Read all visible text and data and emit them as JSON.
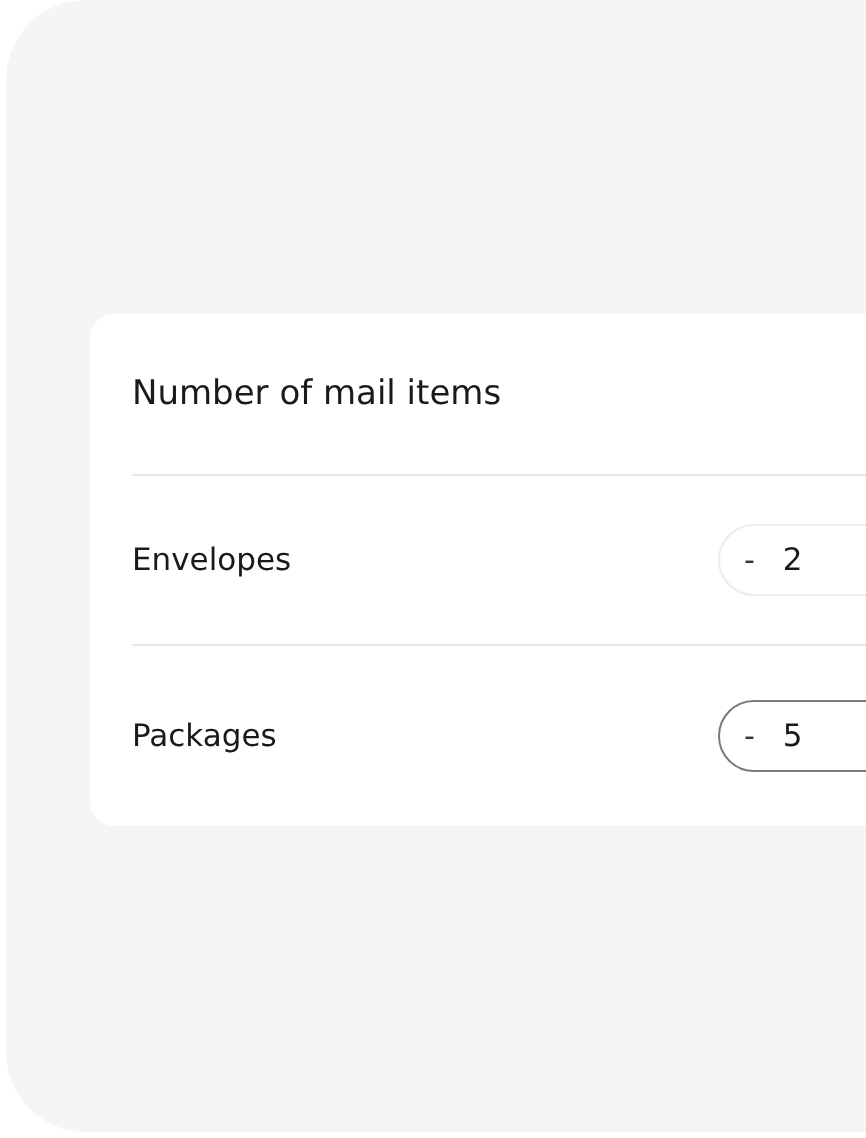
{
  "card": {
    "title": "Number of mail items",
    "items": [
      {
        "label": "Envelopes",
        "decrement": "-",
        "value": "2",
        "selected": false
      },
      {
        "label": "Packages",
        "decrement": "-",
        "value": "5",
        "selected": true
      }
    ]
  }
}
